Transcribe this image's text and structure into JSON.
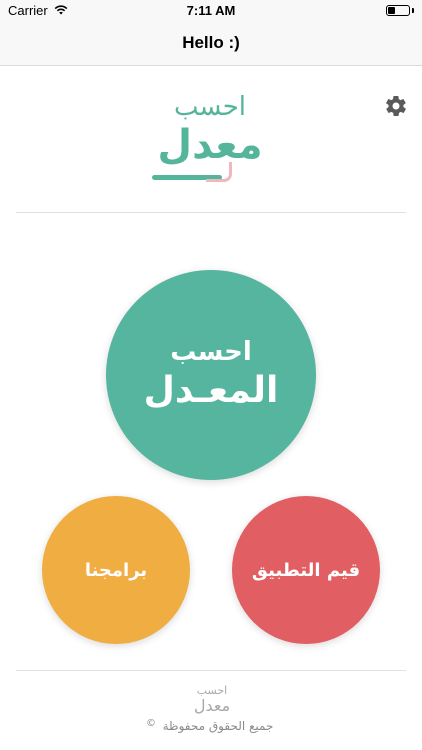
{
  "status_bar": {
    "carrier": "Carrier",
    "time": "7:11 AM",
    "battery_level": 0.35
  },
  "nav": {
    "title": "Hello :)"
  },
  "logo": {
    "title": "احسب",
    "main": "معدل"
  },
  "buttons": {
    "calculate": {
      "line1": "احسب",
      "line2": "المعـدل",
      "color": "#55b59f"
    },
    "our_apps": {
      "label": "برامجنا",
      "color": "#efad42"
    },
    "rate_app": {
      "label": "قيم التطبيق",
      "color": "#e15e62"
    }
  },
  "footer": {
    "logo_title": "احسب",
    "logo_main": "معدل",
    "copyright_symbol": "©",
    "rights": "جميع الحقوق محفوظة"
  },
  "icons": {
    "settings": "gear-icon",
    "wifi": "wifi-icon",
    "battery": "battery-icon"
  }
}
